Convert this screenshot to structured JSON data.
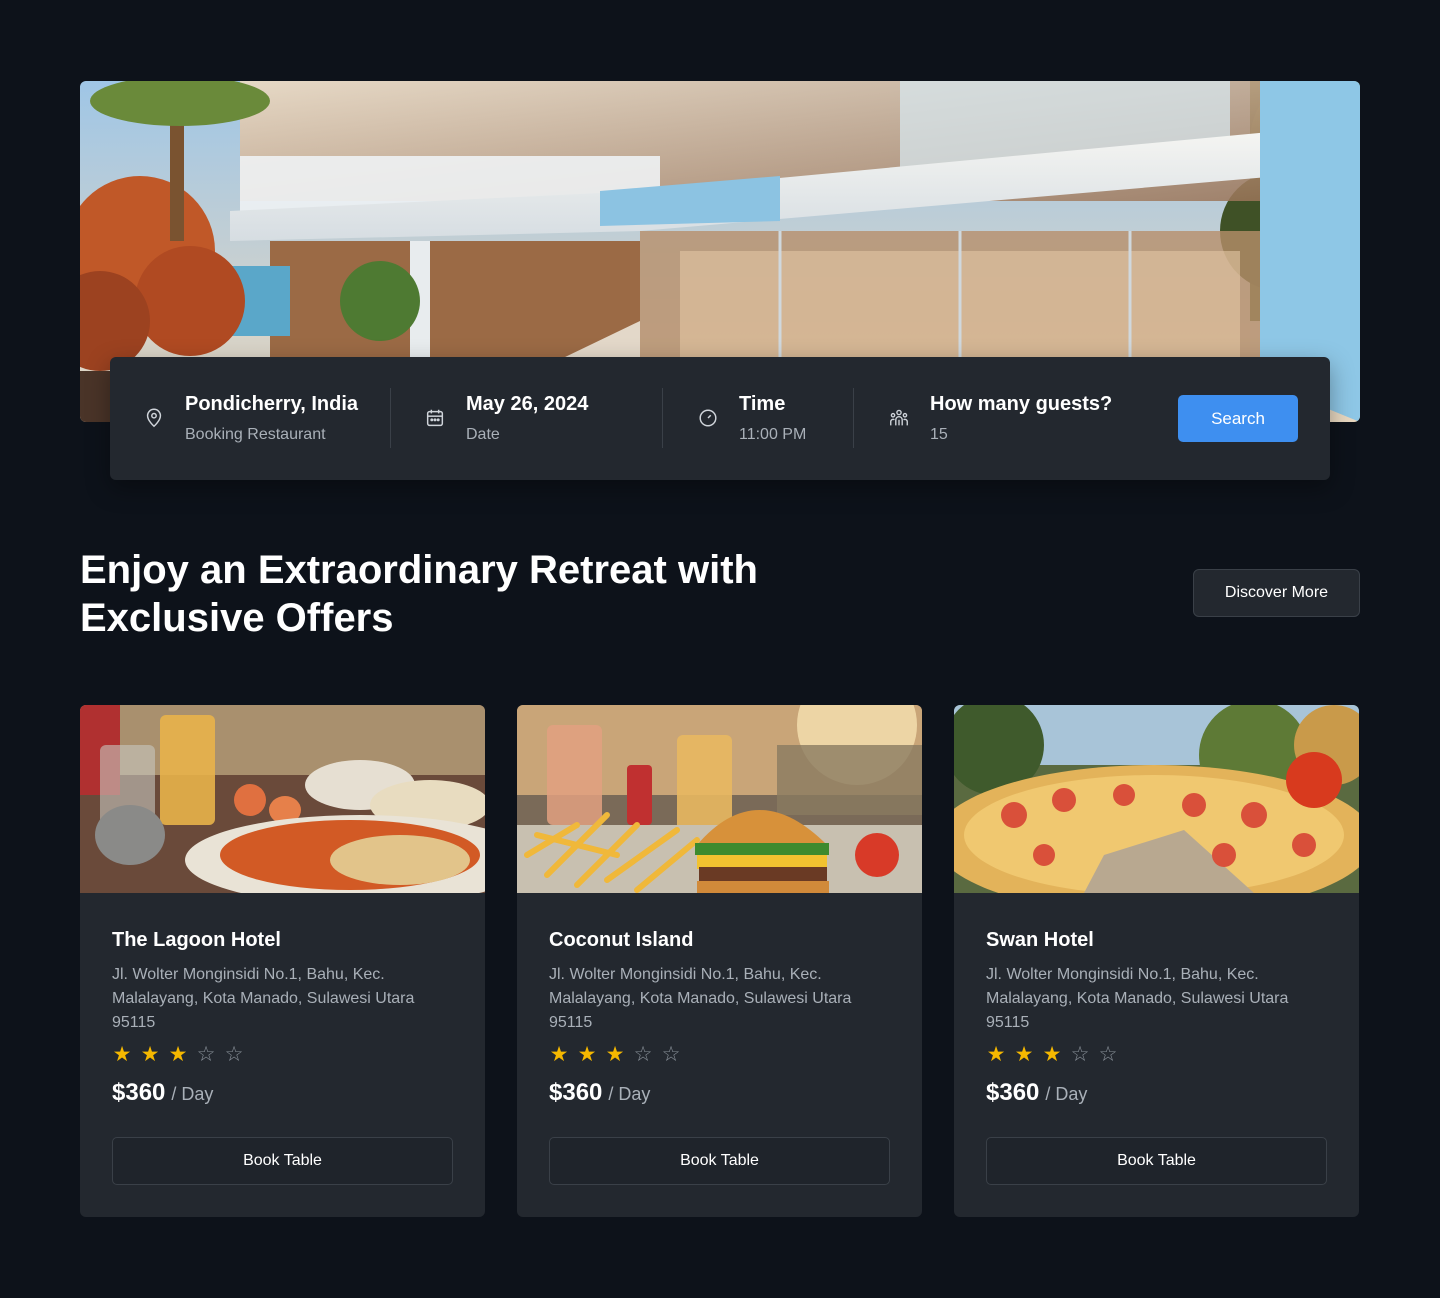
{
  "search": {
    "location": {
      "value": "Pondicherry, India",
      "label": "Booking Restaurant"
    },
    "date": {
      "value": "May 26, 2024",
      "label": "Date"
    },
    "time": {
      "value": "Time",
      "label": "11:00 PM"
    },
    "guests": {
      "value": "How many guests?",
      "label": "15"
    },
    "button_label": "Search"
  },
  "section": {
    "heading_line1": "Enjoy an Extraordinary Retreat with",
    "heading_line2": "Exclusive Offers",
    "discover_label": "Discover More"
  },
  "cards": [
    {
      "name": "The Lagoon Hotel",
      "address": "Jl. Wolter Monginsidi No.1, Bahu, Kec. Malalayang, Kota Manado, Sulawesi Utara 95115",
      "rating": 3,
      "rating_max": 5,
      "price": "$360",
      "per": "/ Day",
      "button_label": "Book Table"
    },
    {
      "name": "Coconut Island",
      "address": "Jl. Wolter Monginsidi No.1, Bahu, Kec. Malalayang, Kota Manado, Sulawesi Utara 95115",
      "rating": 3,
      "rating_max": 5,
      "price": "$360",
      "per": "/ Day",
      "button_label": "Book Table"
    },
    {
      "name": "Swan Hotel",
      "address": "Jl. Wolter Monginsidi No.1, Bahu, Kec. Malalayang, Kota Manado, Sulawesi Utara 95115",
      "rating": 3,
      "rating_max": 5,
      "price": "$360",
      "per": "/ Day",
      "button_label": "Book Table"
    }
  ],
  "colors": {
    "background": "#0d121a",
    "panel": "#23282f",
    "accent": "#3e8ff0",
    "star": "#f5b800"
  },
  "icons": {
    "location": "location-pin-icon",
    "date": "calendar-icon",
    "time": "clock-icon",
    "guests": "users-icon",
    "star_full": "star-filled-icon",
    "star_empty": "star-outline-icon"
  }
}
